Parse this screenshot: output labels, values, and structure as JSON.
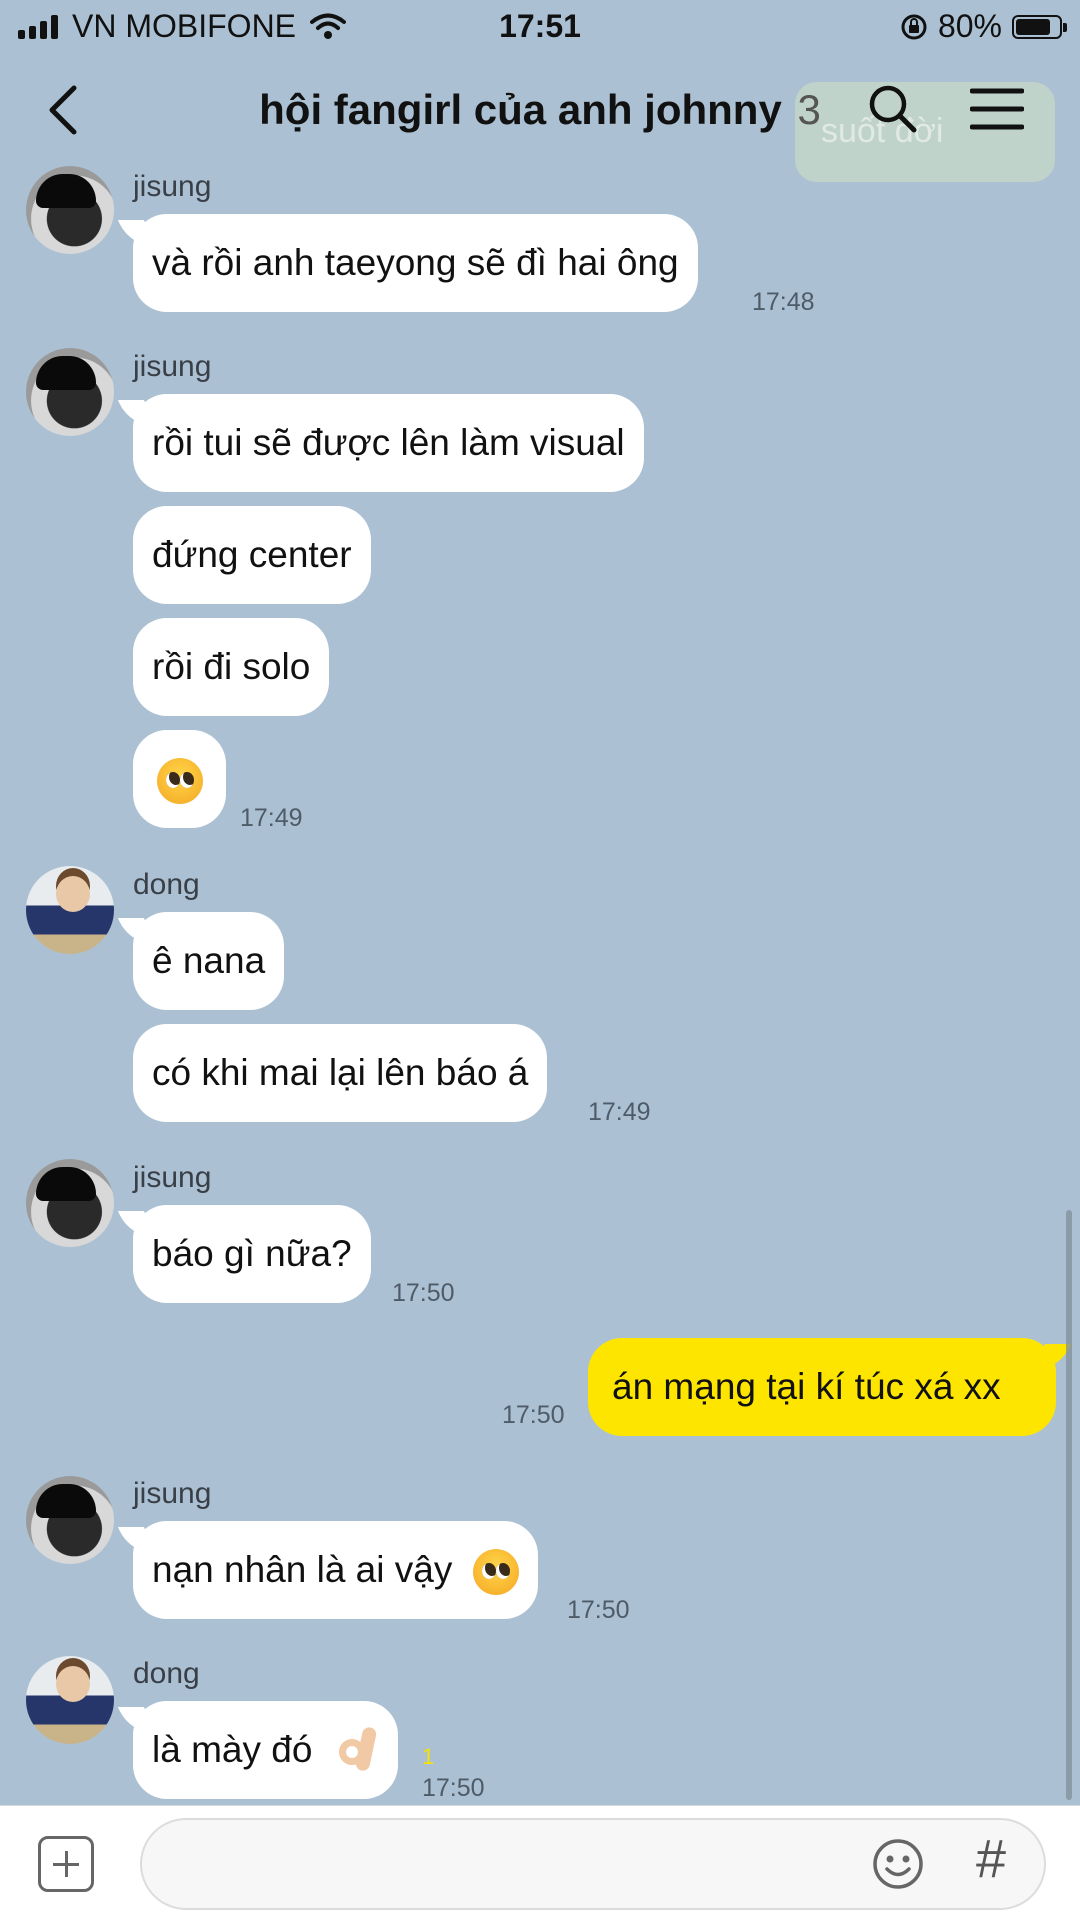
{
  "status_bar": {
    "carrier": "VN MOBIFONE",
    "time": "17:51",
    "battery": "80%",
    "battery_level": 0.8
  },
  "header": {
    "title": "hội fangirl của anh johnny",
    "member_count": "3"
  },
  "toast": {
    "text": "suốt đời"
  },
  "messages": [
    {
      "sender": "jisung",
      "text": "và rồi anh taeyong sẽ đì hai ông",
      "time": "17:48"
    },
    {
      "sender": "jisung",
      "text": "rồi tui sẽ được lên làm visual"
    },
    {
      "text": "đứng center"
    },
    {
      "text": "rồi đi solo"
    },
    {
      "emoji": "pleading-face",
      "time": "17:49"
    },
    {
      "sender": "dong",
      "text": "ê nana"
    },
    {
      "text": "có khi mai lại lên báo á",
      "time": "17:49"
    },
    {
      "sender": "jisung",
      "text": "báo gì nữa?",
      "time": "17:50"
    },
    {
      "mine": true,
      "text": "án mạng tại kí túc xá xx",
      "time": "17:50"
    },
    {
      "sender": "jisung",
      "text": "nạn nhân là ai vậy",
      "emoji": "pleading-face",
      "time": "17:50"
    },
    {
      "sender": "dong",
      "text": "là mày đó",
      "emoji": "ok-hand",
      "unread": "1",
      "time": "17:50"
    }
  ],
  "colors": {
    "background": "#abc1d3",
    "my_bubble": "#fee500",
    "other_bubble": "#ffffff"
  },
  "input_bar": {
    "icons": [
      "plus-icon",
      "emoji-icon",
      "hash-icon"
    ],
    "hash_label": "#"
  }
}
